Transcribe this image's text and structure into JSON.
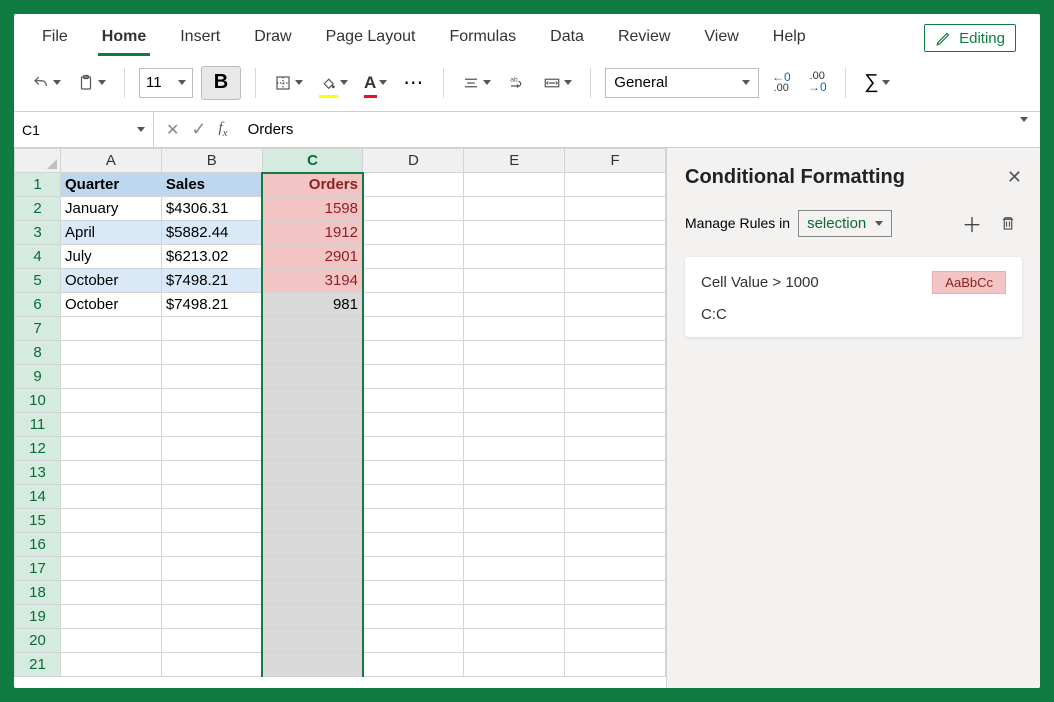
{
  "tabs": [
    "File",
    "Home",
    "Insert",
    "Draw",
    "Page Layout",
    "Formulas",
    "Data",
    "Review",
    "View",
    "Help"
  ],
  "activeTab": "Home",
  "editingLabel": "Editing",
  "toolbar": {
    "fontSize": "11",
    "boldLabel": "B",
    "numberFormat": "General",
    "more": "⋯",
    "dec_left_top": "←0",
    "dec_left_bot": ".00",
    "dec_right_top": ".00",
    "dec_right_bot": "→0",
    "sigma": "∑"
  },
  "nameBox": "C1",
  "formulaValue": "Orders",
  "columns": [
    "A",
    "B",
    "C",
    "D",
    "E",
    "F"
  ],
  "selectedColumn": "C",
  "visibleRows": 21,
  "sheet": {
    "header": {
      "A": "Quarter",
      "B": "Sales",
      "C": "Orders"
    },
    "rows": [
      {
        "A": "January",
        "B": "$4306.31",
        "C": "1598",
        "cf": true
      },
      {
        "A": "April",
        "B": "$5882.44",
        "C": "1912",
        "cf": true
      },
      {
        "A": "July",
        "B": "$6213.02",
        "C": "2901",
        "cf": true
      },
      {
        "A": "October",
        "B": "$7498.21",
        "C": "3194",
        "cf": true
      },
      {
        "A": "October",
        "B": "$7498.21",
        "C": "981",
        "cf": false
      }
    ]
  },
  "panel": {
    "title": "Conditional Formatting",
    "manageLabel": "Manage Rules in",
    "scope": "selection",
    "rule": {
      "text": "Cell Value > 1000",
      "preview": "AaBbCc",
      "range": "C:C"
    }
  }
}
